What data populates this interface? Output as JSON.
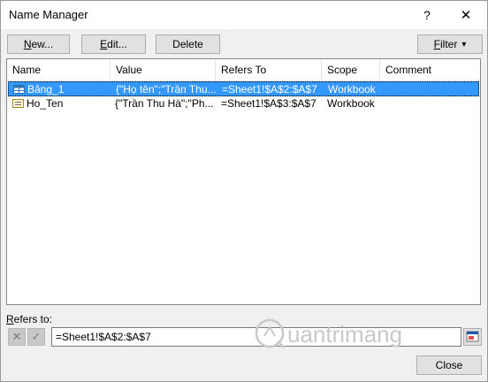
{
  "window": {
    "title": "Name Manager",
    "help_glyph": "?",
    "close_glyph": "✕"
  },
  "toolbar": {
    "new_label_u": "N",
    "new_label_rest": "ew...",
    "edit_label_u": "E",
    "edit_label_rest": "dit...",
    "delete_label": "Delete",
    "filter_label_u": "F",
    "filter_label_rest": "ilter",
    "filter_arrow": "▾"
  },
  "table": {
    "columns": [
      "Name",
      "Value",
      "Refers To",
      "Scope",
      "Comment"
    ],
    "rows": [
      {
        "name": "Bảng_1",
        "value": "{\"Họ tên\";\"Trần Thu...",
        "refers_to": "=Sheet1!$A$2:$A$7",
        "scope": "Workbook",
        "comment": "",
        "icon": "table-name-icon",
        "selected": true
      },
      {
        "name": "Ho_Ten",
        "value": "{\"Trần Thu Hà\";\"Ph...",
        "refers_to": "=Sheet1!$A$3:$A$7",
        "scope": "Workbook",
        "comment": "",
        "icon": "defined-name-icon",
        "selected": false
      }
    ]
  },
  "refers": {
    "label_u": "R",
    "label_rest": "efers to:",
    "value": "=Sheet1!$A$2:$A$7",
    "cancel_glyph": "✕",
    "confirm_glyph": "✓"
  },
  "footer": {
    "close_label": "Close"
  },
  "watermark": {
    "text": "uantrimang"
  },
  "colors": {
    "selection": "#3399ff",
    "dialog_bg": "#f0f0f0",
    "watermark": "#c9c9c9"
  }
}
